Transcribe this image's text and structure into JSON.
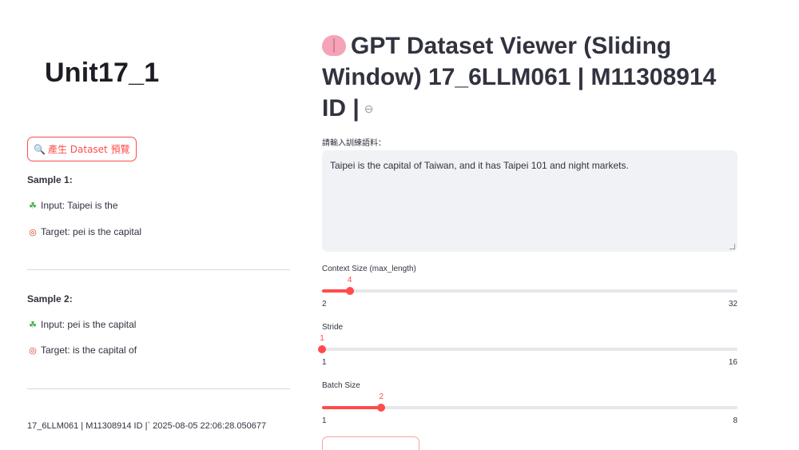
{
  "sidebar": {
    "unit_title": "Unit17_1",
    "generate_button": {
      "icon": "magnifier-icon",
      "label": "產生 Dataset 預覽"
    },
    "samples": [
      {
        "heading": "Sample 1:",
        "input": "Input: Taipei is the",
        "target": "Target: pei is the capital"
      },
      {
        "heading": "Sample 2:",
        "input": "Input: pei is the capital",
        "target": "Target: is the capital of"
      }
    ],
    "footer": "17_6LLM061 | M11308914 ID |` 2025-08-05 22:06:28.050677"
  },
  "main": {
    "title": "GPT Dataset Viewer (Sliding Window) 17_6LLM061 | M11308914 ID |",
    "title_icon": "brain-icon",
    "textarea_label": "請輸入訓練語料：",
    "textarea_value": "Taipei is the capital of Taiwan, and it has Taipei 101 and night markets.",
    "sliders": [
      {
        "label": "Context Size (max_length)",
        "value": 4,
        "min": 2,
        "max": 32,
        "value_text": "4",
        "min_text": "2",
        "max_text": "32"
      },
      {
        "label": "Stride",
        "value": 1,
        "min": 1,
        "max": 16,
        "value_text": "1",
        "min_text": "1",
        "max_text": "16"
      },
      {
        "label": "Batch Size",
        "value": 2,
        "min": 1,
        "max": 8,
        "value_text": "2",
        "min_text": "1",
        "max_text": "8"
      }
    ]
  },
  "colors": {
    "accent": "#ff4b4b",
    "text": "#31333f",
    "input_bg": "#f0f2f6"
  }
}
